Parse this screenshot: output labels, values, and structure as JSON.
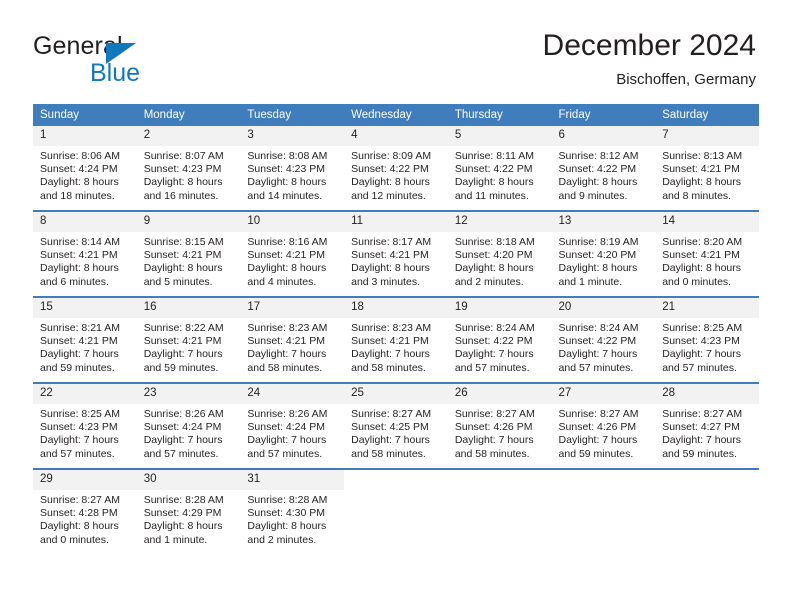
{
  "brand": {
    "name_part1": "General",
    "name_part2": "Blue",
    "triangle_color": "#1278be"
  },
  "header": {
    "title": "December 2024",
    "subtitle": "Bischoffen, Germany"
  },
  "theme": {
    "header_blue": "#3f7dbd",
    "daynum_band": "#f2f2f2",
    "text": "#231f20"
  },
  "weekdays": [
    "Sunday",
    "Monday",
    "Tuesday",
    "Wednesday",
    "Thursday",
    "Friday",
    "Saturday"
  ],
  "weeks": [
    [
      {
        "day": "1",
        "sunrise": "Sunrise: 8:06 AM",
        "sunset": "Sunset: 4:24 PM",
        "daylight1": "Daylight: 8 hours",
        "daylight2": "and 18 minutes."
      },
      {
        "day": "2",
        "sunrise": "Sunrise: 8:07 AM",
        "sunset": "Sunset: 4:23 PM",
        "daylight1": "Daylight: 8 hours",
        "daylight2": "and 16 minutes."
      },
      {
        "day": "3",
        "sunrise": "Sunrise: 8:08 AM",
        "sunset": "Sunset: 4:23 PM",
        "daylight1": "Daylight: 8 hours",
        "daylight2": "and 14 minutes."
      },
      {
        "day": "4",
        "sunrise": "Sunrise: 8:09 AM",
        "sunset": "Sunset: 4:22 PM",
        "daylight1": "Daylight: 8 hours",
        "daylight2": "and 12 minutes."
      },
      {
        "day": "5",
        "sunrise": "Sunrise: 8:11 AM",
        "sunset": "Sunset: 4:22 PM",
        "daylight1": "Daylight: 8 hours",
        "daylight2": "and 11 minutes."
      },
      {
        "day": "6",
        "sunrise": "Sunrise: 8:12 AM",
        "sunset": "Sunset: 4:22 PM",
        "daylight1": "Daylight: 8 hours",
        "daylight2": "and 9 minutes."
      },
      {
        "day": "7",
        "sunrise": "Sunrise: 8:13 AM",
        "sunset": "Sunset: 4:21 PM",
        "daylight1": "Daylight: 8 hours",
        "daylight2": "and 8 minutes."
      }
    ],
    [
      {
        "day": "8",
        "sunrise": "Sunrise: 8:14 AM",
        "sunset": "Sunset: 4:21 PM",
        "daylight1": "Daylight: 8 hours",
        "daylight2": "and 6 minutes."
      },
      {
        "day": "9",
        "sunrise": "Sunrise: 8:15 AM",
        "sunset": "Sunset: 4:21 PM",
        "daylight1": "Daylight: 8 hours",
        "daylight2": "and 5 minutes."
      },
      {
        "day": "10",
        "sunrise": "Sunrise: 8:16 AM",
        "sunset": "Sunset: 4:21 PM",
        "daylight1": "Daylight: 8 hours",
        "daylight2": "and 4 minutes."
      },
      {
        "day": "11",
        "sunrise": "Sunrise: 8:17 AM",
        "sunset": "Sunset: 4:21 PM",
        "daylight1": "Daylight: 8 hours",
        "daylight2": "and 3 minutes."
      },
      {
        "day": "12",
        "sunrise": "Sunrise: 8:18 AM",
        "sunset": "Sunset: 4:20 PM",
        "daylight1": "Daylight: 8 hours",
        "daylight2": "and 2 minutes."
      },
      {
        "day": "13",
        "sunrise": "Sunrise: 8:19 AM",
        "sunset": "Sunset: 4:20 PM",
        "daylight1": "Daylight: 8 hours",
        "daylight2": "and 1 minute."
      },
      {
        "day": "14",
        "sunrise": "Sunrise: 8:20 AM",
        "sunset": "Sunset: 4:21 PM",
        "daylight1": "Daylight: 8 hours",
        "daylight2": "and 0 minutes."
      }
    ],
    [
      {
        "day": "15",
        "sunrise": "Sunrise: 8:21 AM",
        "sunset": "Sunset: 4:21 PM",
        "daylight1": "Daylight: 7 hours",
        "daylight2": "and 59 minutes."
      },
      {
        "day": "16",
        "sunrise": "Sunrise: 8:22 AM",
        "sunset": "Sunset: 4:21 PM",
        "daylight1": "Daylight: 7 hours",
        "daylight2": "and 59 minutes."
      },
      {
        "day": "17",
        "sunrise": "Sunrise: 8:23 AM",
        "sunset": "Sunset: 4:21 PM",
        "daylight1": "Daylight: 7 hours",
        "daylight2": "and 58 minutes."
      },
      {
        "day": "18",
        "sunrise": "Sunrise: 8:23 AM",
        "sunset": "Sunset: 4:21 PM",
        "daylight1": "Daylight: 7 hours",
        "daylight2": "and 58 minutes."
      },
      {
        "day": "19",
        "sunrise": "Sunrise: 8:24 AM",
        "sunset": "Sunset: 4:22 PM",
        "daylight1": "Daylight: 7 hours",
        "daylight2": "and 57 minutes."
      },
      {
        "day": "20",
        "sunrise": "Sunrise: 8:24 AM",
        "sunset": "Sunset: 4:22 PM",
        "daylight1": "Daylight: 7 hours",
        "daylight2": "and 57 minutes."
      },
      {
        "day": "21",
        "sunrise": "Sunrise: 8:25 AM",
        "sunset": "Sunset: 4:23 PM",
        "daylight1": "Daylight: 7 hours",
        "daylight2": "and 57 minutes."
      }
    ],
    [
      {
        "day": "22",
        "sunrise": "Sunrise: 8:25 AM",
        "sunset": "Sunset: 4:23 PM",
        "daylight1": "Daylight: 7 hours",
        "daylight2": "and 57 minutes."
      },
      {
        "day": "23",
        "sunrise": "Sunrise: 8:26 AM",
        "sunset": "Sunset: 4:24 PM",
        "daylight1": "Daylight: 7 hours",
        "daylight2": "and 57 minutes."
      },
      {
        "day": "24",
        "sunrise": "Sunrise: 8:26 AM",
        "sunset": "Sunset: 4:24 PM",
        "daylight1": "Daylight: 7 hours",
        "daylight2": "and 57 minutes."
      },
      {
        "day": "25",
        "sunrise": "Sunrise: 8:27 AM",
        "sunset": "Sunset: 4:25 PM",
        "daylight1": "Daylight: 7 hours",
        "daylight2": "and 58 minutes."
      },
      {
        "day": "26",
        "sunrise": "Sunrise: 8:27 AM",
        "sunset": "Sunset: 4:26 PM",
        "daylight1": "Daylight: 7 hours",
        "daylight2": "and 58 minutes."
      },
      {
        "day": "27",
        "sunrise": "Sunrise: 8:27 AM",
        "sunset": "Sunset: 4:26 PM",
        "daylight1": "Daylight: 7 hours",
        "daylight2": "and 59 minutes."
      },
      {
        "day": "28",
        "sunrise": "Sunrise: 8:27 AM",
        "sunset": "Sunset: 4:27 PM",
        "daylight1": "Daylight: 7 hours",
        "daylight2": "and 59 minutes."
      }
    ],
    [
      {
        "day": "29",
        "sunrise": "Sunrise: 8:27 AM",
        "sunset": "Sunset: 4:28 PM",
        "daylight1": "Daylight: 8 hours",
        "daylight2": "and 0 minutes."
      },
      {
        "day": "30",
        "sunrise": "Sunrise: 8:28 AM",
        "sunset": "Sunset: 4:29 PM",
        "daylight1": "Daylight: 8 hours",
        "daylight2": "and 1 minute."
      },
      {
        "day": "31",
        "sunrise": "Sunrise: 8:28 AM",
        "sunset": "Sunset: 4:30 PM",
        "daylight1": "Daylight: 8 hours",
        "daylight2": "and 2 minutes."
      },
      {
        "day": "",
        "sunrise": "",
        "sunset": "",
        "daylight1": "",
        "daylight2": ""
      },
      {
        "day": "",
        "sunrise": "",
        "sunset": "",
        "daylight1": "",
        "daylight2": ""
      },
      {
        "day": "",
        "sunrise": "",
        "sunset": "",
        "daylight1": "",
        "daylight2": ""
      },
      {
        "day": "",
        "sunrise": "",
        "sunset": "",
        "daylight1": "",
        "daylight2": ""
      }
    ]
  ]
}
